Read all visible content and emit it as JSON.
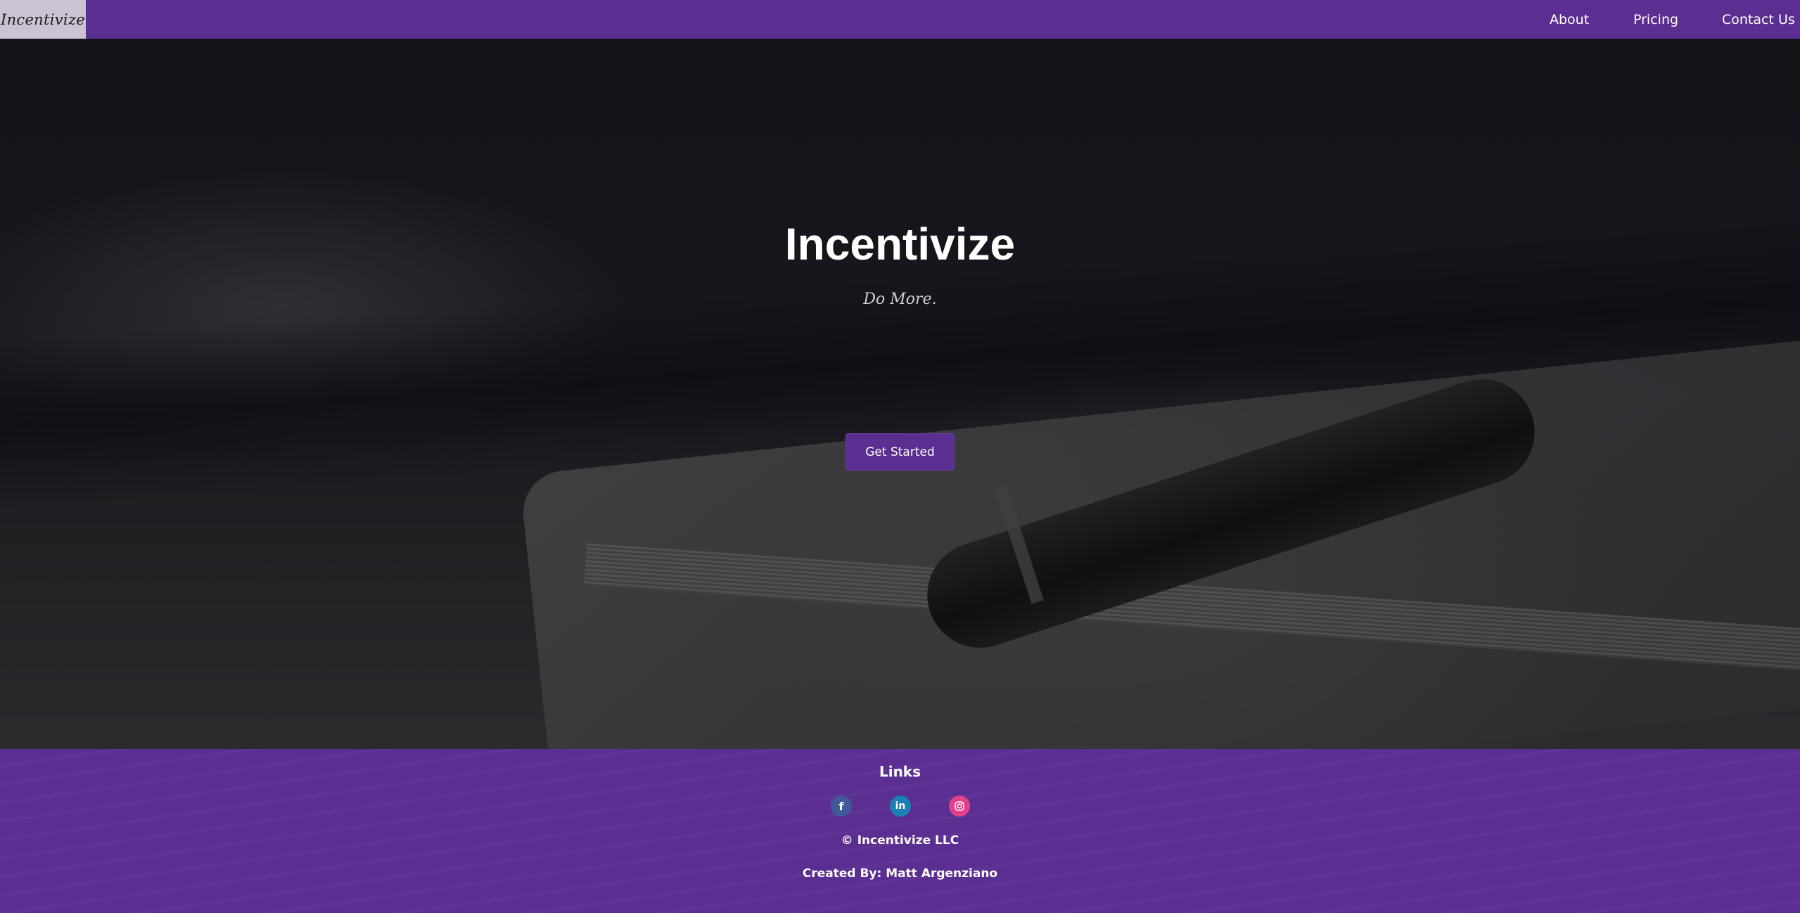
{
  "navbar": {
    "brand": "Incentivize",
    "links": [
      {
        "label": "About"
      },
      {
        "label": "Pricing"
      },
      {
        "label": "Contact Us"
      }
    ]
  },
  "hero": {
    "title": "Incentivize",
    "tagline": "Do More.",
    "cta_label": "Get Started",
    "background_image": "notebook-and-pen-photo"
  },
  "footer": {
    "heading": "Links",
    "social": [
      {
        "glyph": "f",
        "icon": "facebook-icon",
        "color": "#3f5a97"
      },
      {
        "glyph": "in",
        "icon": "linkedin-icon",
        "color": "#1a7fb3"
      },
      {
        "glyph": "",
        "icon": "instagram-icon",
        "color": "#e2408a"
      }
    ],
    "copyright": "© Incentivize LLC",
    "credit": "Created By: Matt Argenziano"
  },
  "colors": {
    "brand_purple": "#5b2f91",
    "brand_box": "#cbc2d2",
    "text_light": "#ffffff"
  }
}
